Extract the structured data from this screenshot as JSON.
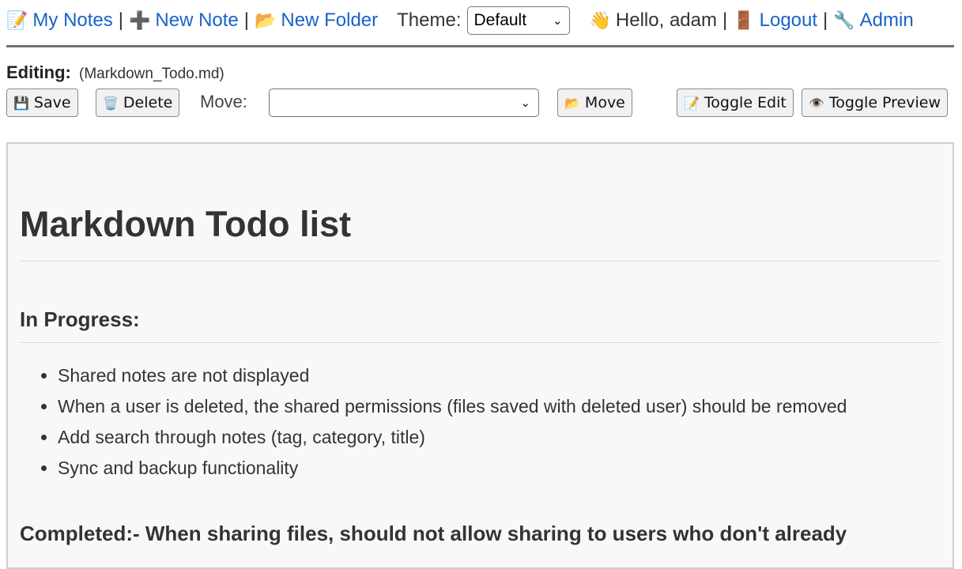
{
  "nav": {
    "my_notes": "My Notes",
    "my_notes_icon": "📝",
    "new_note": "New Note",
    "new_note_icon": "➕",
    "new_folder": "New Folder",
    "new_folder_icon": "📂",
    "separator": "|",
    "theme_label": "Theme:",
    "theme_value": "Default",
    "greeting": "Hello, adam",
    "greeting_icon": "👋",
    "logout": "Logout",
    "logout_icon": "🚪",
    "admin": "Admin",
    "admin_icon": "🔧"
  },
  "editor": {
    "editing_label": "Editing:",
    "filename": "(Markdown_Todo.md)",
    "save_label": "Save",
    "save_icon": "💾",
    "delete_label": "Delete",
    "delete_icon": "🗑️",
    "move_label": "Move:",
    "move_select_value": "",
    "move_button_label": "Move",
    "move_button_icon": "📂",
    "toggle_edit_label": "Toggle Edit",
    "toggle_edit_icon": "📝",
    "toggle_preview_label": "Toggle Preview",
    "toggle_preview_icon": "👁️"
  },
  "preview": {
    "title": "Markdown Todo list",
    "in_progress_heading": "In Progress:",
    "in_progress_items": [
      "Shared notes are not displayed",
      "When a user is deleted, the shared permissions (files saved with deleted user) should be removed",
      "Add search through notes (tag, category, title)",
      "Sync and backup functionality"
    ],
    "completed_heading": "Completed:- When sharing files, should not allow sharing to users who don't already"
  },
  "colors": {
    "link": "#1a62c9",
    "content_bg": "#f8f8f8",
    "rule": "#707070"
  }
}
